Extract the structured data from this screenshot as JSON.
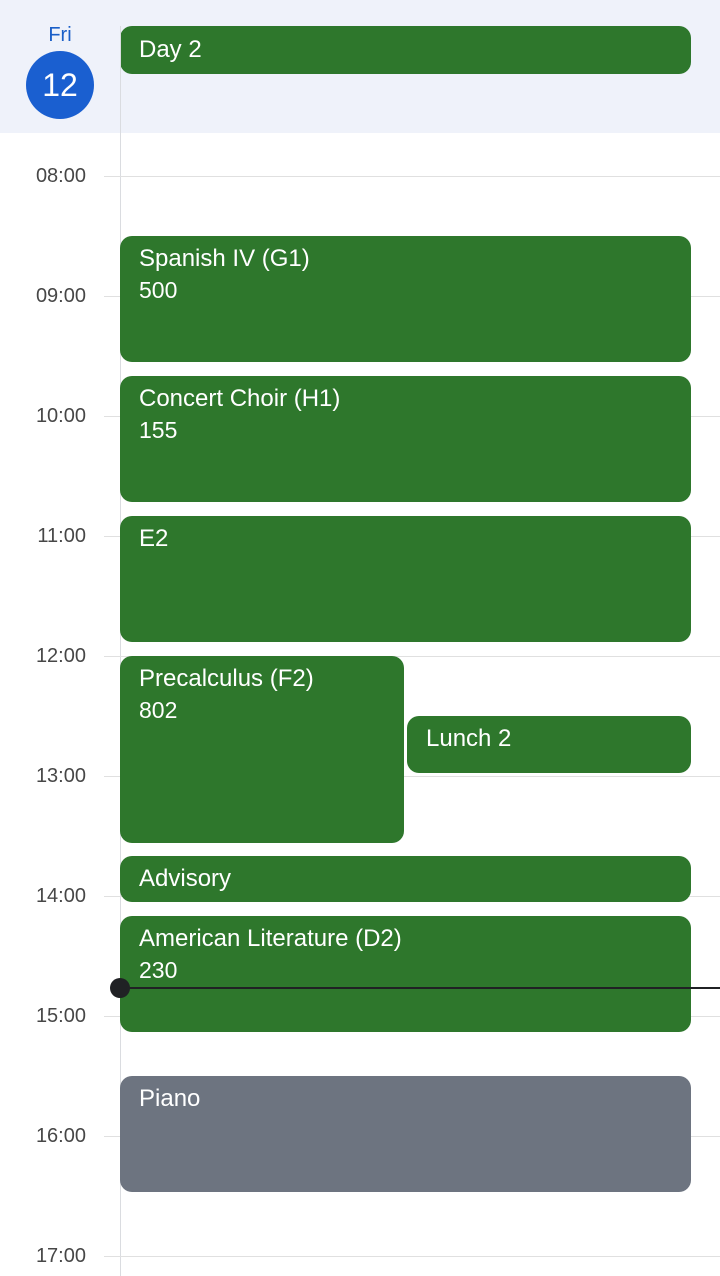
{
  "header": {
    "day_name": "Fri",
    "day_number": "12",
    "all_day_event": "Day 2"
  },
  "hours": [
    "08:00",
    "09:00",
    "10:00",
    "11:00",
    "12:00",
    "13:00",
    "14:00",
    "15:00",
    "16:00",
    "17:00"
  ],
  "events": [
    {
      "title": "Spanish IV (G1)",
      "room": "500",
      "start": "08:45",
      "end": "09:50"
    },
    {
      "title": "Concert Choir (H1)",
      "room": "155",
      "start": "09:55",
      "end": "11:00"
    },
    {
      "title": "E2",
      "room": "",
      "start": "11:05",
      "end": "12:10"
    },
    {
      "title": "Precalculus (F2)",
      "room": "802",
      "start": "12:15",
      "end": "13:50"
    },
    {
      "title": "Lunch 2",
      "room": "",
      "start": "12:45",
      "end": "13:15"
    },
    {
      "title": "Advisory",
      "room": "",
      "start": "13:55",
      "end": "14:20"
    },
    {
      "title": "American Literature (D2)",
      "room": "230",
      "start": "14:25",
      "end": "15:25"
    },
    {
      "title": "Piano",
      "room": "",
      "start": "15:45",
      "end": "16:45"
    }
  ],
  "current_time_indicator": true,
  "colors": {
    "event_green": "#2e772c",
    "event_gray": "#6d7480",
    "today_blue": "#1a5fd0",
    "header_bg": "#eff2fa"
  }
}
